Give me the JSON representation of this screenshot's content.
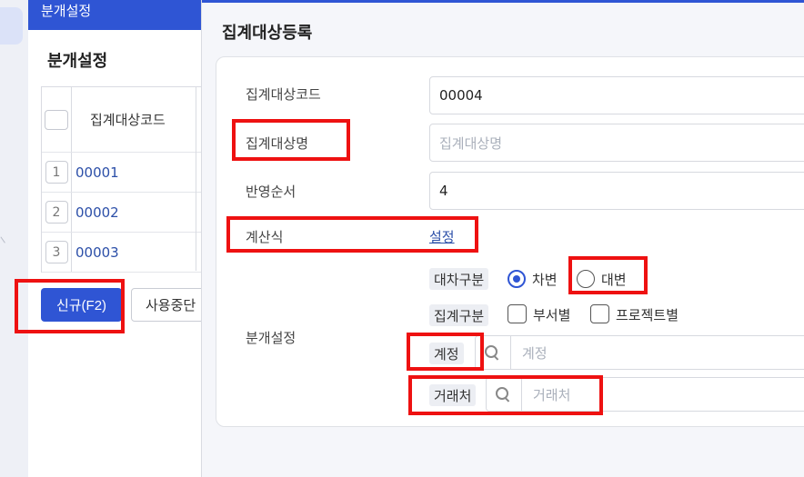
{
  "background_page": {
    "header_title": "분개설정",
    "page_title": "분개설정",
    "grid": {
      "column_header": "집계대상코드",
      "rows": [
        {
          "num": "1",
          "code": "00001"
        },
        {
          "num": "2",
          "code": "00002"
        },
        {
          "num": "3",
          "code": "00003"
        }
      ]
    },
    "buttons": {
      "new_label": "신규(F2)",
      "in_use_label": "사용중단"
    }
  },
  "modal": {
    "title": "집계대상등록",
    "fields": {
      "code_label": "집계대상코드",
      "code_value": "00004",
      "name_label": "집계대상명",
      "name_placeholder": "집계대상명",
      "order_label": "반영순서",
      "order_value": "4",
      "formula_label": "계산식",
      "formula_link": "설정"
    },
    "journal": {
      "section_label": "분개설정",
      "debit_credit_tag": "대차구분",
      "debit_label": "차변",
      "credit_label": "대변",
      "selected": "차변",
      "group_tag": "집계구분",
      "by_department_label": "부서별",
      "by_project_label": "프로젝트별",
      "account_tag": "계정",
      "account_placeholder": "계정",
      "partner_tag": "거래처",
      "partner_placeholder": "거래처"
    }
  },
  "colors": {
    "primary": "#2f55d4",
    "annotation": "#e11111"
  }
}
